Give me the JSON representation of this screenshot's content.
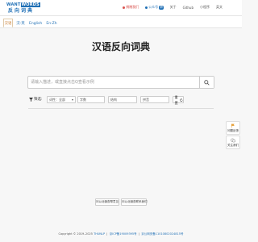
{
  "header": {
    "logo_top_a": "WANT",
    "logo_top_b": "WORDS",
    "logo_bottom": "反向词典",
    "nav": {
      "donate": "捐赠我们",
      "tutorial": "公众号",
      "tutorial_badge": "新",
      "about": "关于",
      "github": "Github",
      "miniapp": "小程序",
      "english": "英文"
    }
  },
  "tabs": [
    "汉语",
    "汉-英",
    "English",
    "En-Zh"
  ],
  "main": {
    "title": "汉语反向词典",
    "search_placeholder": "请输入描述，或直接点击Q查看示例"
  },
  "filters": {
    "label": "筛选:",
    "part_of_speech": "词性：全部",
    "word_count": "字数",
    "pinyin": "结构",
    "first_letter": "拼音",
    "reset": "重置"
  },
  "side": {
    "feedback": "问题反馈",
    "follow": "关注我们"
  },
  "bottom": {
    "help": "问以北倒查帮意见",
    "contact": "问以北倒查联系我们"
  },
  "footer": {
    "copyright": "Copyright © 2019–2025",
    "org": "THUNLP",
    "icp": "京ICP备19009395号",
    "police": "京公网安备11010802024815号"
  },
  "colors": {
    "brand": "#1f6fb5",
    "accent": "#c8792a",
    "danger": "#d9534f"
  }
}
